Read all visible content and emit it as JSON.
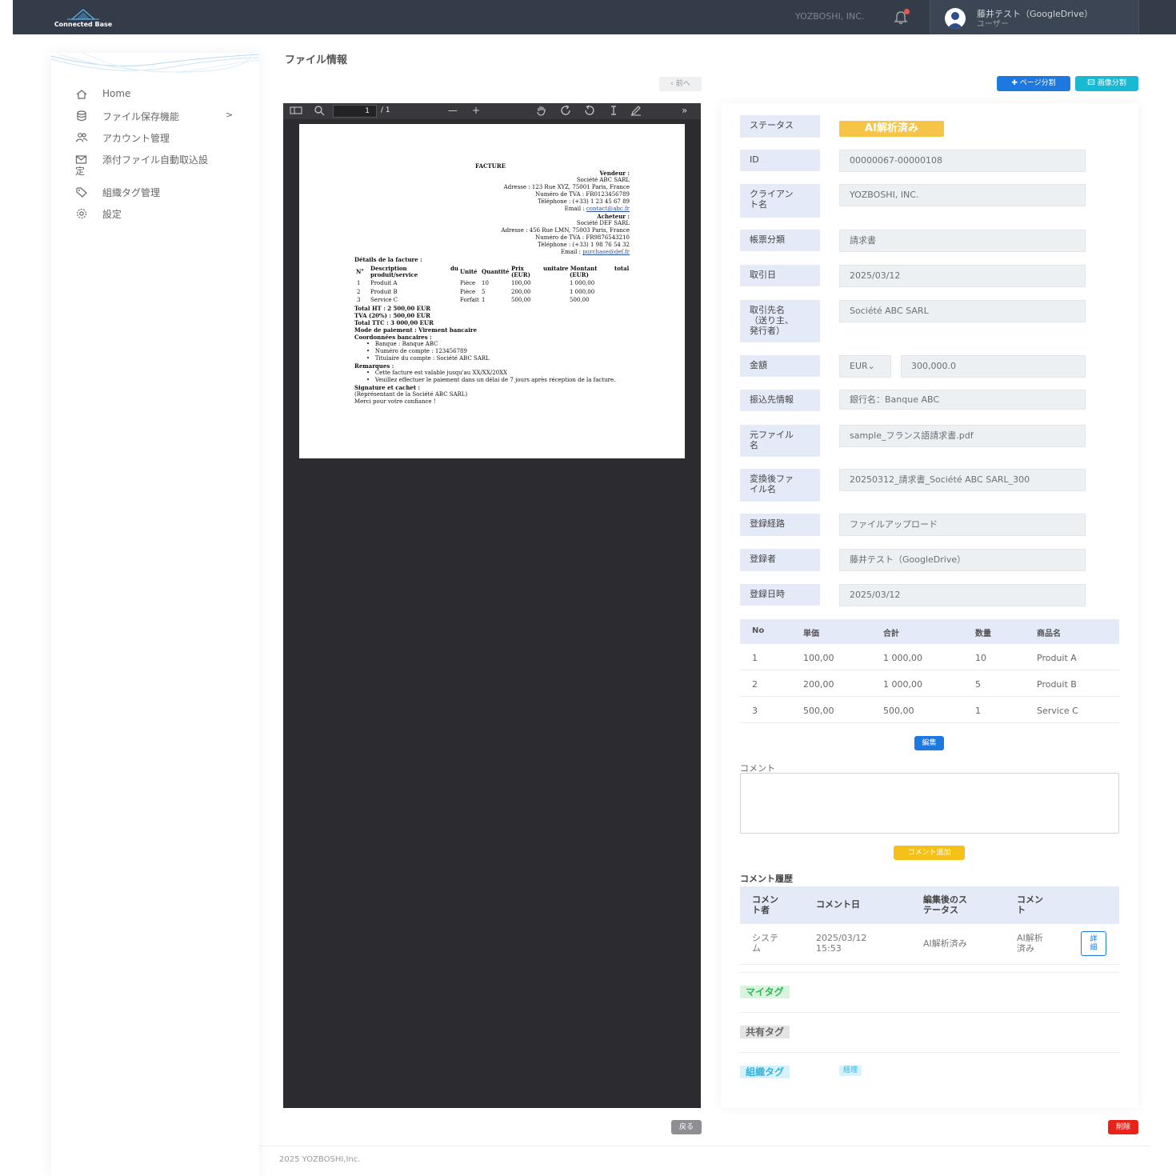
{
  "header": {
    "logo_text": "Connected Base",
    "company": "YOZBOSHI, INC.",
    "user_name": "藤井テスト（GoogleDrive）",
    "user_role": "ユーザー"
  },
  "sidebar": {
    "items": [
      {
        "label": "Home",
        "icon": "home-icon"
      },
      {
        "label": "ファイル保存機能",
        "icon": "database-icon",
        "chevron": ">"
      },
      {
        "label": "アカウント管理",
        "icon": "users-icon"
      },
      {
        "label": "添付ファイル自動取込設",
        "label2": "定",
        "icon": "mail-import-icon"
      },
      {
        "label": "組織タグ管理",
        "icon": "tag-icon"
      },
      {
        "label": "設定",
        "icon": "gear-icon"
      }
    ]
  },
  "page": {
    "title": "ファイル情報",
    "prev": "‹ 前へ",
    "page_split": "✚ ページ分割",
    "image_split": "🖾 画像分割"
  },
  "viewer": {
    "page_number": "1",
    "page_count": "/ 1",
    "doc": {
      "title": "FACTURE",
      "seller": [
        "Vendeur :",
        "Société ABC SARL",
        "Adresse : 123 Rue XYZ, 75001 Paris, France",
        "Numéro de TVA : FR0123456789",
        "Téléphone : (+33) 1 23 45 67 89"
      ],
      "seller_email_label": "Email : ",
      "seller_email": "contact@abc.fr",
      "buyer": [
        "Acheteur :",
        "Société DEF SARL",
        "Adresse : 456 Rue LMN, 75003 Paris, France",
        "Numéro de TVA : FR9876543210",
        "Téléphone : (+33) 1 98 76 54 32"
      ],
      "buyer_email_label": "Email : ",
      "buyer_email": "purchase@def.fr",
      "details_title": "Détails de la facture :",
      "th_no": "N°",
      "th_desc1": "Description",
      "th_desc2": "produit/service",
      "th_du": "du",
      "th_unit": "Unité",
      "th_qty": "Quantité",
      "th_price1": "Prix",
      "th_price2": "(EUR)",
      "th_unitamt": "unitaire Montant",
      "th_unitamt2": "(EUR)",
      "th_total": "total",
      "rows": [
        {
          "no": "1",
          "desc": "Produit A",
          "unit": "Pièce",
          "qty": "10",
          "price": "100,00",
          "amount": "1 000,00"
        },
        {
          "no": "2",
          "desc": "Produit B",
          "unit": "Pièce",
          "qty": "5",
          "price": "200,00",
          "amount": "1 000,00"
        },
        {
          "no": "3",
          "desc": "Service C",
          "unit": "Forfait",
          "qty": "1",
          "price": "500,00",
          "amount": "500,00"
        }
      ],
      "totals": [
        "Total HT : 2 500,00 EUR",
        "TVA (20%) : 500,00 EUR",
        "Total TTC : 3 000,00 EUR",
        "Mode de paiement : Virement bancaire",
        "Coordonnées bancaires :"
      ],
      "bank": [
        "Banque : Banque ABC",
        "Numéro de compte : 123456789",
        "Titulaire du compte : Société ABC SARL"
      ],
      "remarks_title": "Remarques :",
      "remarks": [
        "Cette facture est valable jusqu'au XX/XX/20XX",
        "Veuillez effectuer le paiement dans un délai de 7 jours après réception de la facture."
      ],
      "signature": [
        "Signature et cachet :",
        "(Représentant de la Société ABC SARL)",
        "Merci pour votre confiance !"
      ]
    }
  },
  "fields": {
    "status_label": "ステータス",
    "status_value": "AI解析済み",
    "id_label": "ID",
    "id_value": "00000067-00000108",
    "client_label_1": "クライアン",
    "client_label_2": "ト名",
    "client_value": "YOZBOSHI, INC.",
    "doc_type_label": "帳票分類",
    "doc_type_value": "請求書",
    "date_label": "取引日",
    "date_value": "2025/03/12",
    "partner_label_1": "取引先名",
    "partner_label_2": "（送り主、",
    "partner_label_3": "発行者）",
    "partner_value": "Société ABC SARL",
    "amount_label": "金額",
    "currency_value": "EUR",
    "amount_value": "300,000.0",
    "bank_label": "振込先情報",
    "bank_value": "銀行名：Banque ABC",
    "orig_label_1": "元ファイル",
    "orig_label_2": "名",
    "orig_value": "sample_フランス語請求書.pdf",
    "conv_label_1": "変換後ファ",
    "conv_label_2": "イル名",
    "conv_value": "20250312_請求書_Société ABC SARL_300",
    "route_label": "登録経路",
    "route_value": "ファイルアップロード",
    "registrant_label": "登録者",
    "registrant_value": "藤井テスト（GoogleDrive）",
    "reg_date_label": "登録日時",
    "reg_date_value": "2025/03/12"
  },
  "items": {
    "headers": {
      "no": "No",
      "price": "単価",
      "total": "合計",
      "qty": "数量",
      "name": "商品名"
    },
    "rows": [
      {
        "no": "1",
        "price": "100,00",
        "total": "1 000,00",
        "qty": "10",
        "name": "Produit A"
      },
      {
        "no": "2",
        "price": "200,00",
        "total": "1 000,00",
        "qty": "5",
        "name": "Produit B"
      },
      {
        "no": "3",
        "price": "500,00",
        "total": "500,00",
        "qty": "1",
        "name": "Service C"
      }
    ],
    "edit": "編集"
  },
  "comment": {
    "label": "コメント",
    "add": "コメント追加",
    "history_title": "コメント履歴",
    "h_author_1": "コメン",
    "h_author_2": "ト者",
    "h_date": "コメント日",
    "h_status_1": "編集後のス",
    "h_status_2": "テータス",
    "h_comment_1": "コメン",
    "h_comment_2": "ト",
    "r_author_1": "システ",
    "r_author_2": "ム",
    "r_date_1": "2025/03/12",
    "r_date_2": "15:53",
    "r_status": "AI解析済み",
    "r_comment_1": "AI解析",
    "r_comment_2": "済み",
    "detail_1": "詳",
    "detail_2": "細"
  },
  "tags": {
    "my": "マイタグ",
    "shared": "共有タグ",
    "org": "組織タグ",
    "org_chip": "経理"
  },
  "actions": {
    "back": "戻る",
    "delete": "削除"
  },
  "footer": "2025 YOZBOSHI,Inc."
}
